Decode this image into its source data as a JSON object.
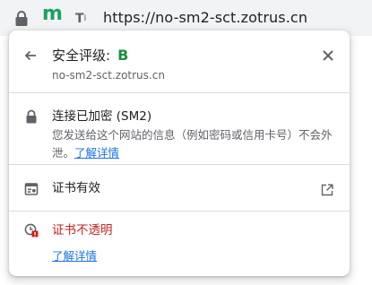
{
  "omnibox": {
    "m_logo": "m",
    "tt_label": "T",
    "tt_sub": "I",
    "url": "https://no-sm2-sct.zotrus.cn"
  },
  "popup": {
    "title": "安全评级:",
    "grade": "B",
    "domain": "no-sm2-sct.zotrus.cn",
    "connection": {
      "title": "连接已加密 (SM2)",
      "description": "您发送给这个网站的信息（例如密码或信用卡号）不会外泄。",
      "learn_more": "了解详情"
    },
    "certificate": {
      "label": "证书有效"
    },
    "transparency": {
      "label": "证书不透明",
      "learn_more": "了解详情"
    }
  },
  "colors": {
    "grade_green": "#1e8e3e",
    "warning_red": "#c5221f",
    "link_blue": "#1a73e8",
    "logo_green": "#1aa260"
  },
  "icons": [
    "lock-icon",
    "tt-icon",
    "back-arrow-icon",
    "close-icon",
    "certificate-icon",
    "external-link-icon",
    "cert-warning-icon"
  ]
}
